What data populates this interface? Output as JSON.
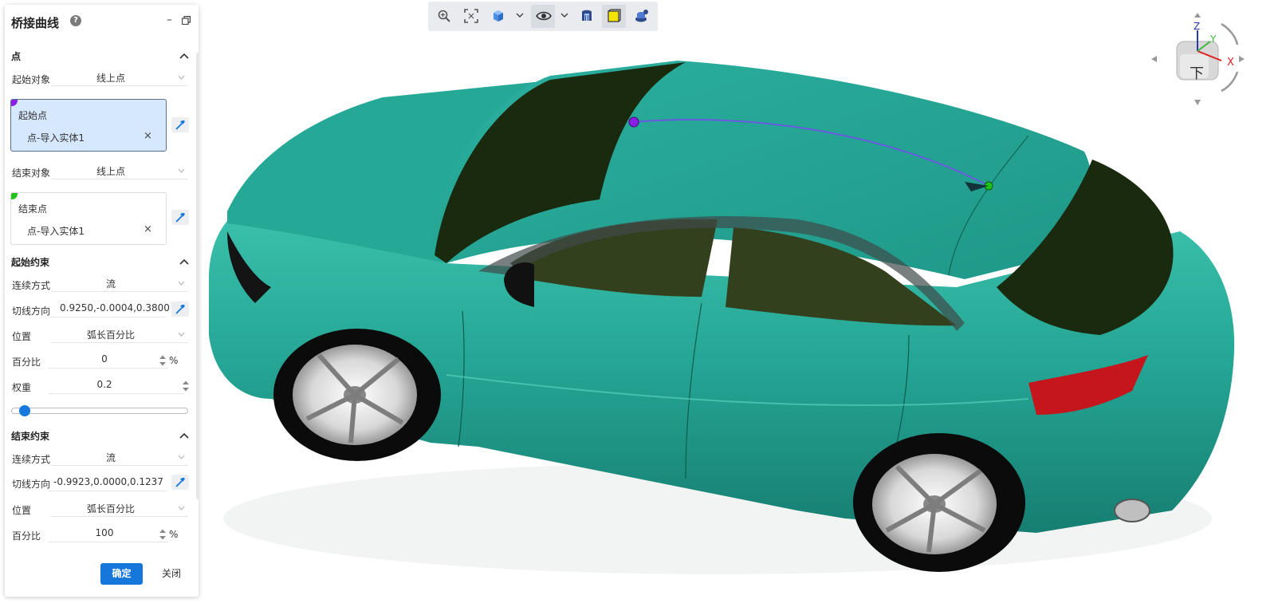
{
  "panel": {
    "title": "桥接曲线",
    "help_glyph": "?",
    "minimize_glyph": "–",
    "point_section": {
      "title": "点",
      "start_object_label": "起始对象",
      "start_object_value": "线上点",
      "start_point_label": "起始点",
      "start_point_value": "点-导入实体1",
      "start_point_color": "#8a1fe6",
      "end_object_label": "结束对象",
      "end_object_value": "线上点",
      "end_point_label": "结束点",
      "end_point_value": "点-导入实体1",
      "end_point_color": "#21c21b",
      "clear_glyph": "×"
    },
    "start_constraint": {
      "title": "起始约束",
      "continuity_label": "连续方式",
      "continuity_value": "流",
      "tangent_label": "切线方向",
      "tangent_value": "0.9250,-0.0004,0.3800",
      "position_label": "位置",
      "position_value": "弧长百分比",
      "percent_label": "百分比",
      "percent_value": "0",
      "percent_unit": "%",
      "weight_label": "权重",
      "weight_value": "0.2",
      "weight_slider_fraction": 0.04
    },
    "end_constraint": {
      "title": "结束约束",
      "continuity_label": "连续方式",
      "continuity_value": "流",
      "tangent_label": "切线方向",
      "tangent_value": "-0.9923,0.0000,0.1237",
      "position_label": "位置",
      "position_value": "弧长百分比",
      "percent_label": "百分比",
      "percent_value": "100",
      "percent_unit": "%"
    },
    "ok_label": "确定",
    "close_label": "关闭"
  },
  "toolbar": {
    "buttons": [
      "zoom-icon",
      "fit-view-icon",
      "cube-view-icon",
      "eye-icon",
      "section-icon",
      "shaded-box-icon",
      "render-icon"
    ]
  },
  "navcube": {
    "face_label": "下",
    "axis_x": "X",
    "axis_y": "Y",
    "axis_z": "Z"
  },
  "colors": {
    "accent": "#1677db",
    "car_body": "#23a392",
    "glass": "#1c2a10",
    "start_point": "#8a1fe6",
    "end_point": "#21c21b",
    "curve": "#6a5ae0"
  }
}
